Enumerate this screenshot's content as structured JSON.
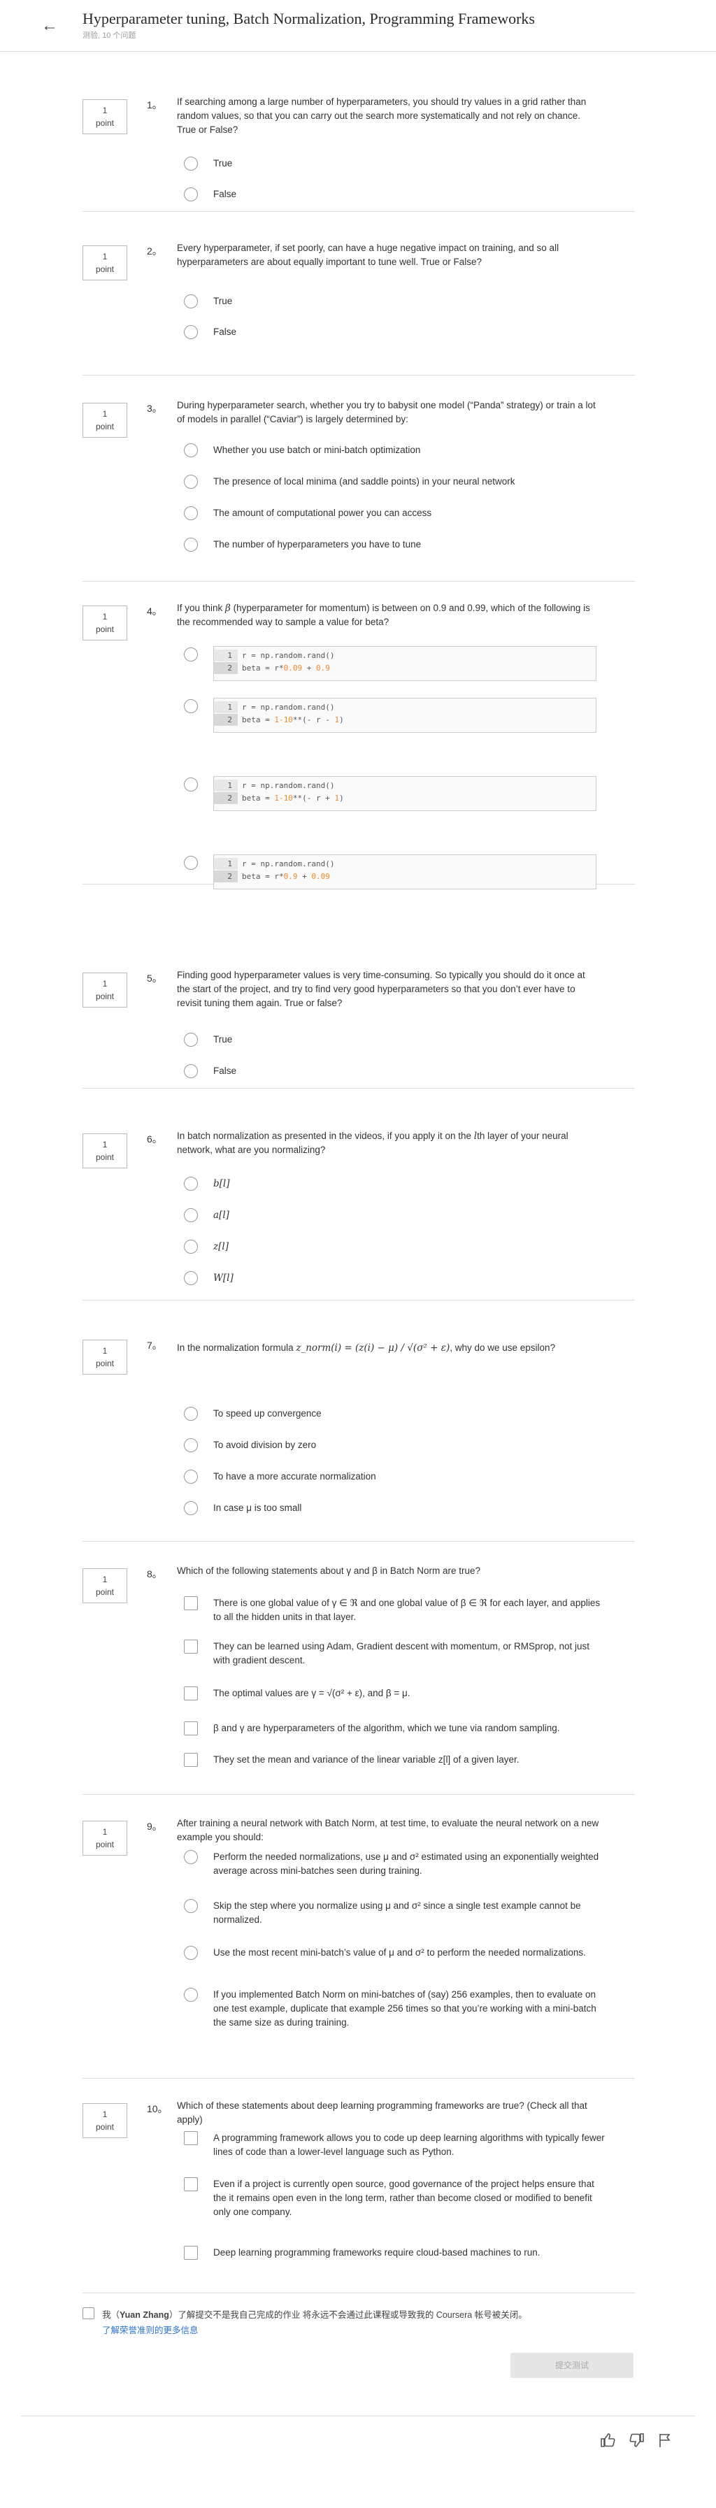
{
  "header": {
    "title": "Hyperparameter tuning, Batch Normalization, Programming Frameworks",
    "subtitle": "测验, 10 个问题"
  },
  "points_label": {
    "value": "1",
    "unit": "point"
  },
  "questions": [
    {
      "num": "1",
      "text": "If searching among a large number of hyperparameters, you should try values in a grid rather than random values, so that you can carry out the search more systematically and not rely on chance. True or False?",
      "options": [
        "True",
        "False"
      ]
    },
    {
      "num": "2",
      "text": "Every hyperparameter, if set poorly, can have a huge negative impact on training, and so all hyperparameters are about equally important to tune well. True or False?",
      "options": [
        "True",
        "False"
      ]
    },
    {
      "num": "3",
      "text": "During hyperparameter search, whether you try to babysit one model (“Panda” strategy) or train a lot of models in parallel (“Caviar”) is largely determined by:",
      "options": [
        "Whether you use batch or mini-batch optimization",
        "The presence of local minima (and saddle points) in your neural network",
        "The amount of computational power you can access",
        "The number of hyperparameters you have to tune"
      ]
    },
    {
      "num": "4",
      "text_a": "If you think ",
      "text_sym": "β",
      "text_b": " (hyperparameter for momentum) is between on 0.9 and 0.99, which of the following is the recommended way to sample a value for beta?",
      "code_options": [
        {
          "l1": "r = np.random.rand()",
          "l2a": "beta = r*",
          "l2b": "0.09",
          "l2c": " + ",
          "l2d": "0.9",
          "l2e": ""
        },
        {
          "l1": "r = np.random.rand()",
          "l2a": "beta = ",
          "l2b": "1-10",
          "l2c": "**(- r - ",
          "l2d": "1",
          "l2e": ")"
        },
        {
          "l1": "r = np.random.rand()",
          "l2a": "beta = ",
          "l2b": "1-10",
          "l2c": "**(- r + ",
          "l2d": "1",
          "l2e": ")"
        },
        {
          "l1": "r = np.random.rand()",
          "l2a": "beta = r*",
          "l2b": "0.9",
          "l2c": " + ",
          "l2d": "0.09",
          "l2e": ""
        }
      ],
      "line_numbers": [
        "1",
        "2"
      ]
    },
    {
      "num": "5",
      "text": "Finding good hyperparameter values is very time-consuming. So typically you should do it once at the start of the project, and try to find very good hyperparameters so that you don’t ever have to revisit tuning them again. True or false?",
      "options": [
        "True",
        "False"
      ]
    },
    {
      "num": "6",
      "text_a": "In batch normalization as presented in the videos, if you apply it on the ",
      "text_sym": "l",
      "text_b": "th layer of your neural network, what are you normalizing?",
      "options": [
        "b[l]",
        "a[l]",
        "z[l]",
        "W[l]"
      ]
    },
    {
      "num": "7",
      "text_a": "In the normalization formula ",
      "formula": "z_norm(i) = (z(i) − μ) / √(σ² + ε)",
      "text_b": ", why do we use epsilon?",
      "options": [
        "To speed up convergence",
        "To avoid division by zero",
        "To have a more accurate normalization",
        "In case μ is too small"
      ]
    },
    {
      "num": "8",
      "text": "Which of the following statements about γ and β in Batch Norm are true?",
      "options": [
        "There is one global value of γ ∈ ℜ and one global value of β ∈ ℜ for each layer, and applies to all the hidden units in that layer.",
        "They can be learned using Adam, Gradient descent with momentum, or RMSprop, not just with gradient descent.",
        "The optimal values are γ = √(σ² + ε), and β = μ.",
        "β and γ are hyperparameters of the algorithm, which we tune via random sampling.",
        "They set the mean and variance of the linear variable z[l] of a given layer."
      ]
    },
    {
      "num": "9",
      "text": "After training a neural network with Batch Norm, at test time, to evaluate the neural network on a new example you should:",
      "options": [
        "Perform the needed normalizations, use μ and σ² estimated using an exponentially weighted average across mini-batches seen during training.",
        "Skip the step where you normalize using μ and σ² since a single test example cannot be normalized.",
        "Use the most recent mini-batch’s value of μ and σ² to perform the needed normalizations.",
        "If you implemented Batch Norm on mini-batches of (say) 256 examples, then to evaluate on one test example, duplicate that example 256 times so that you’re working with a mini-batch the same size as during training."
      ]
    },
    {
      "num": "10",
      "text": "Which of these statements about deep learning programming frameworks are true? (Check all that apply)",
      "options": [
        "A programming framework allows you to code up deep learning algorithms with typically fewer lines of code than a lower-level language such as Python.",
        "Even if a project is currently open source, good governance of the project helps ensure that the it remains open even in the long term, rather than become closed or modified to benefit only one company.",
        "Deep learning programming frameworks require cloud-based machines to run."
      ]
    }
  ],
  "honor": {
    "prefix": "我（",
    "name": "Yuan Zhang",
    "suffix": "）了解提交不是我自己完成的作业 将永远不会通过此课程或导致我的 Coursera 帐号被关闭。",
    "link": "了解荣誉准则的更多信息"
  },
  "submit_label": "提交测试",
  "footer_icons": [
    "thumbs-up-icon",
    "thumbs-down-icon",
    "flag-icon"
  ]
}
